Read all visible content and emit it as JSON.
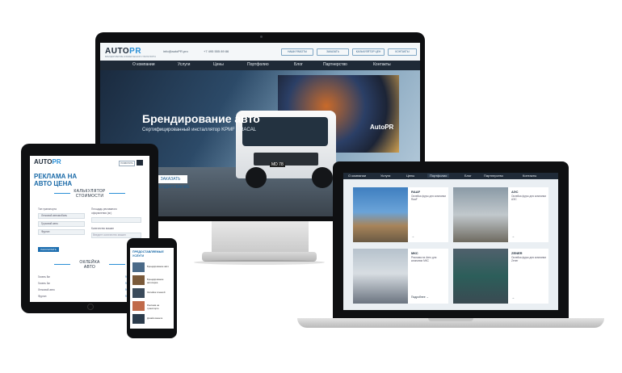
{
  "desktop": {
    "logo_text": "AUTO",
    "logo_accent": "PR",
    "logo_sub": "БРЕНДИРОВАНИЕ КОММЕРЧЕСКОГО ТРАНСПОРТА",
    "email": "info@autoPR.pro",
    "phone": "+7 495 555 89 86",
    "top_buttons": [
      "НАШИ РАБОТЫ",
      "ЗАКАЗАТЬ",
      "КАЛЬКУЛЯТОР ЦЕН",
      "КОНТАКТЫ"
    ],
    "nav": [
      "О компании",
      "Услуги",
      "Цены",
      "Портфолио",
      "Блог",
      "Партнерство",
      "Контакты"
    ],
    "hero_title": "Брендирование авто",
    "hero_subtitle": "Сертифицированный инсталлятор KPMF ORACAL",
    "hero_button": "ЗАКАЗАТЬ БРЕНДИРОВАНИЕ",
    "plate": "MD 78",
    "truck_logo": "AutoPR"
  },
  "tablet": {
    "logo_text": "AUTO",
    "logo_accent": "PR",
    "phone_btn": "ПОЗВОНИТЬ",
    "headline_1": "РЕКЛАМА НА",
    "headline_2": "АВТО ЦЕНА",
    "calc_title_1": "КАЛЬКУЛЯТОР",
    "calc_title_2": "СТОИМОСТИ",
    "form_left_label": "Тип транспорта",
    "form_left_opts": [
      "Легковой автомобиль",
      "Грузовой авто",
      "Фургон"
    ],
    "form_right_label_1": "Площадь рекламного",
    "form_right_label_2": "оформления (м²)",
    "form_right_label_3": "Количество машин",
    "form_right_hint": "Введите количество машин",
    "calc_button": "РАССЧИТАТЬ",
    "section2_1": "ОКЛЕЙКА",
    "section2_2": "АВТО",
    "list_rows": [
      "Газель 5м",
      "Газель 3м",
      "Легковой авто",
      "Фургон"
    ],
    "list_prices": [
      "999 р",
      "999 р",
      "999 р",
      "999 р"
    ]
  },
  "phone": {
    "title_1": "ПРЕДОСТАВЛЯЕМЫЕ",
    "title_2": "УСЛУГИ",
    "items": [
      "Брендирование авто",
      "Брендирование автопарка",
      "Оклейка пленкой",
      "Реклама на транспорте",
      "Дизайн макета"
    ]
  },
  "laptop": {
    "nav": [
      "О компании",
      "Услуги",
      "Цены",
      "Портфолио",
      "Блог",
      "Партнерство",
      "Контакты"
    ],
    "nav_active": "Портфолио",
    "cards": [
      {
        "title": "RAAF",
        "text": "Оклейка фуры для компании RaaF"
      },
      {
        "title": "АЭС",
        "text": "Оклейка фуры для компании АЭС"
      },
      {
        "title": "МКС",
        "text": "Реклама на Авто для компании МКС"
      },
      {
        "title": "ZENER",
        "text": "Оклейка фуры для компании Zener"
      }
    ],
    "more_label": "Подробнее"
  }
}
